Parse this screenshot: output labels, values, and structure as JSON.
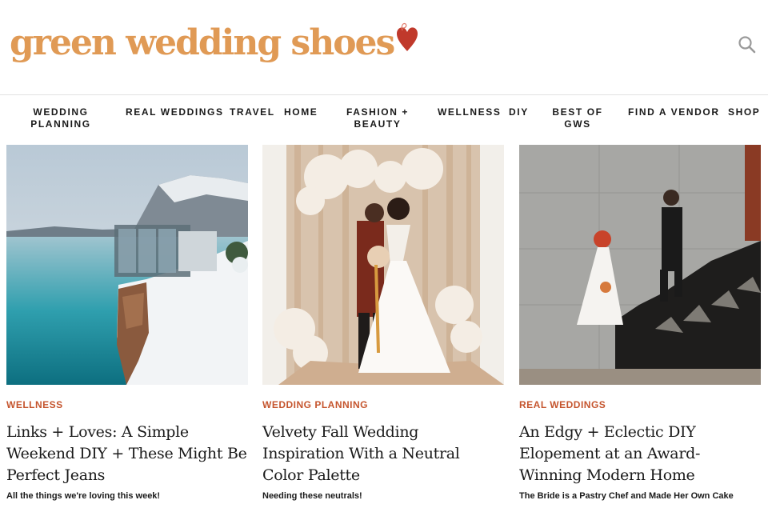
{
  "header": {
    "logo_text": "green wedding shoes",
    "logo_icon": "heart-icon",
    "search_icon": "search-icon"
  },
  "nav": {
    "items": [
      {
        "label": "WEDDING PLANNING"
      },
      {
        "label": "REAL WEDDINGS"
      },
      {
        "label": "TRAVEL"
      },
      {
        "label": "HOME"
      },
      {
        "label": "FASHION + BEAUTY"
      },
      {
        "label": "WELLNESS"
      },
      {
        "label": "DIY"
      },
      {
        "label": "BEST OF GWS"
      },
      {
        "label": "FIND A VENDOR"
      },
      {
        "label": "SHOP"
      }
    ]
  },
  "posts": [
    {
      "category": "WELLNESS",
      "title": "Links + Loves: A Simple Weekend DIY + These Might Be Perfect Jeans",
      "excerpt": "All the things we're loving this week!"
    },
    {
      "category": "WEDDING PLANNING",
      "title": "Velvety Fall Wedding Inspiration With a Neutral Color Palette",
      "excerpt": "Needing these neutrals!"
    },
    {
      "category": "REAL WEDDINGS",
      "title": "An Edgy + Eclectic DIY Elopement at an Award-Winning Modern Home",
      "excerpt": "The Bride is a Pastry Chef and Made Her Own Cake"
    }
  ],
  "colors": {
    "logo": "#e09a55",
    "heart": "#c0392b",
    "category": "#c5552e"
  }
}
